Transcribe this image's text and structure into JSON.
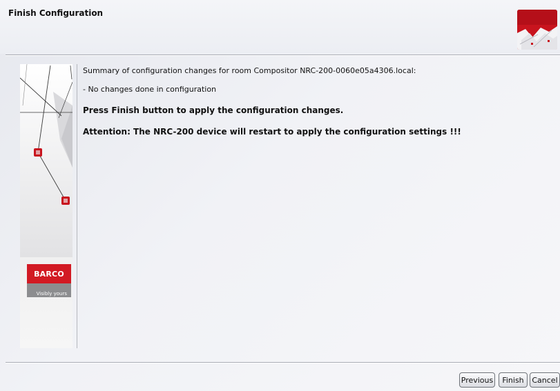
{
  "window": {
    "title": "Finish Configuration"
  },
  "content": {
    "summary": "Summary of configuration changes for room Compositor NRC-200-0060e05a4306.local:",
    "no_changes": "- No changes done in configuration",
    "press_finish": "Press Finish button to apply the configuration changes.",
    "attention": "Attention: The NRC-200 device will restart to apply the configuration settings !!!"
  },
  "branding": {
    "logo_text": "BARCO",
    "tagline": "Visibly yours"
  },
  "buttons": {
    "previous": "Previous",
    "finish": "Finish",
    "cancel": "Cancel"
  },
  "colors": {
    "brand_red": "#d21a23",
    "brand_gray": "#8c8d8f"
  },
  "icons": {
    "header_logo": "barco-corner-logo-icon",
    "side_graphic": "network-lines-graphic"
  }
}
